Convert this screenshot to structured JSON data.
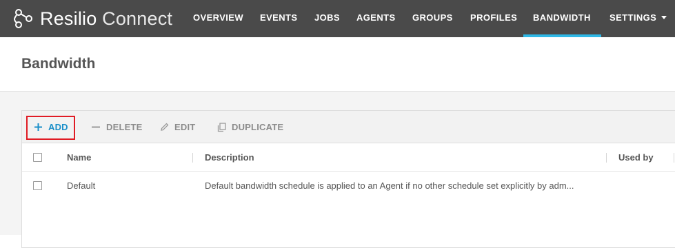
{
  "app": {
    "brand": "Resilio",
    "product": "Connect",
    "logo_icon": "resilio-logo-icon"
  },
  "nav": {
    "items": [
      {
        "label": "OVERVIEW"
      },
      {
        "label": "EVENTS"
      },
      {
        "label": "JOBS"
      },
      {
        "label": "AGENTS"
      },
      {
        "label": "GROUPS"
      },
      {
        "label": "PROFILES"
      },
      {
        "label": "BANDWIDTH",
        "active": true
      },
      {
        "label": "SETTINGS",
        "has_dropdown": true
      }
    ],
    "active_color": "#2eb8e6"
  },
  "page": {
    "title": "Bandwidth"
  },
  "toolbar": {
    "add_label": "ADD",
    "delete_label": "DELETE",
    "edit_label": "EDIT",
    "duplicate_label": "DUPLICATE",
    "add_color": "#1a8fc9",
    "highlight_color": "#e01b24"
  },
  "table": {
    "columns": [
      "Name",
      "Description",
      "Used by"
    ],
    "rows": [
      {
        "name": "Default",
        "description": "Default bandwidth schedule is applied to an Agent if no other schedule set explicitly by adm...",
        "used_by": ""
      }
    ]
  }
}
